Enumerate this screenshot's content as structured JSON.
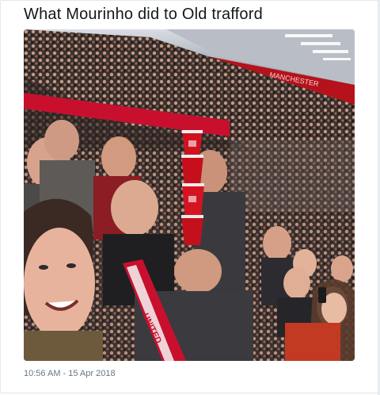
{
  "tweet": {
    "text": "What Mourinho did to Old trafford",
    "timestamp": "10:56 AM - 15 Apr 2018"
  },
  "photo": {
    "stadium_sign_text": "MANCHESTER",
    "scarf_text": "UNITED",
    "icon": "crowd-photo"
  },
  "colors": {
    "text_primary": "#14171a",
    "text_secondary": "#657786",
    "border": "#e1e8ed",
    "united_red": "#c8102e"
  }
}
